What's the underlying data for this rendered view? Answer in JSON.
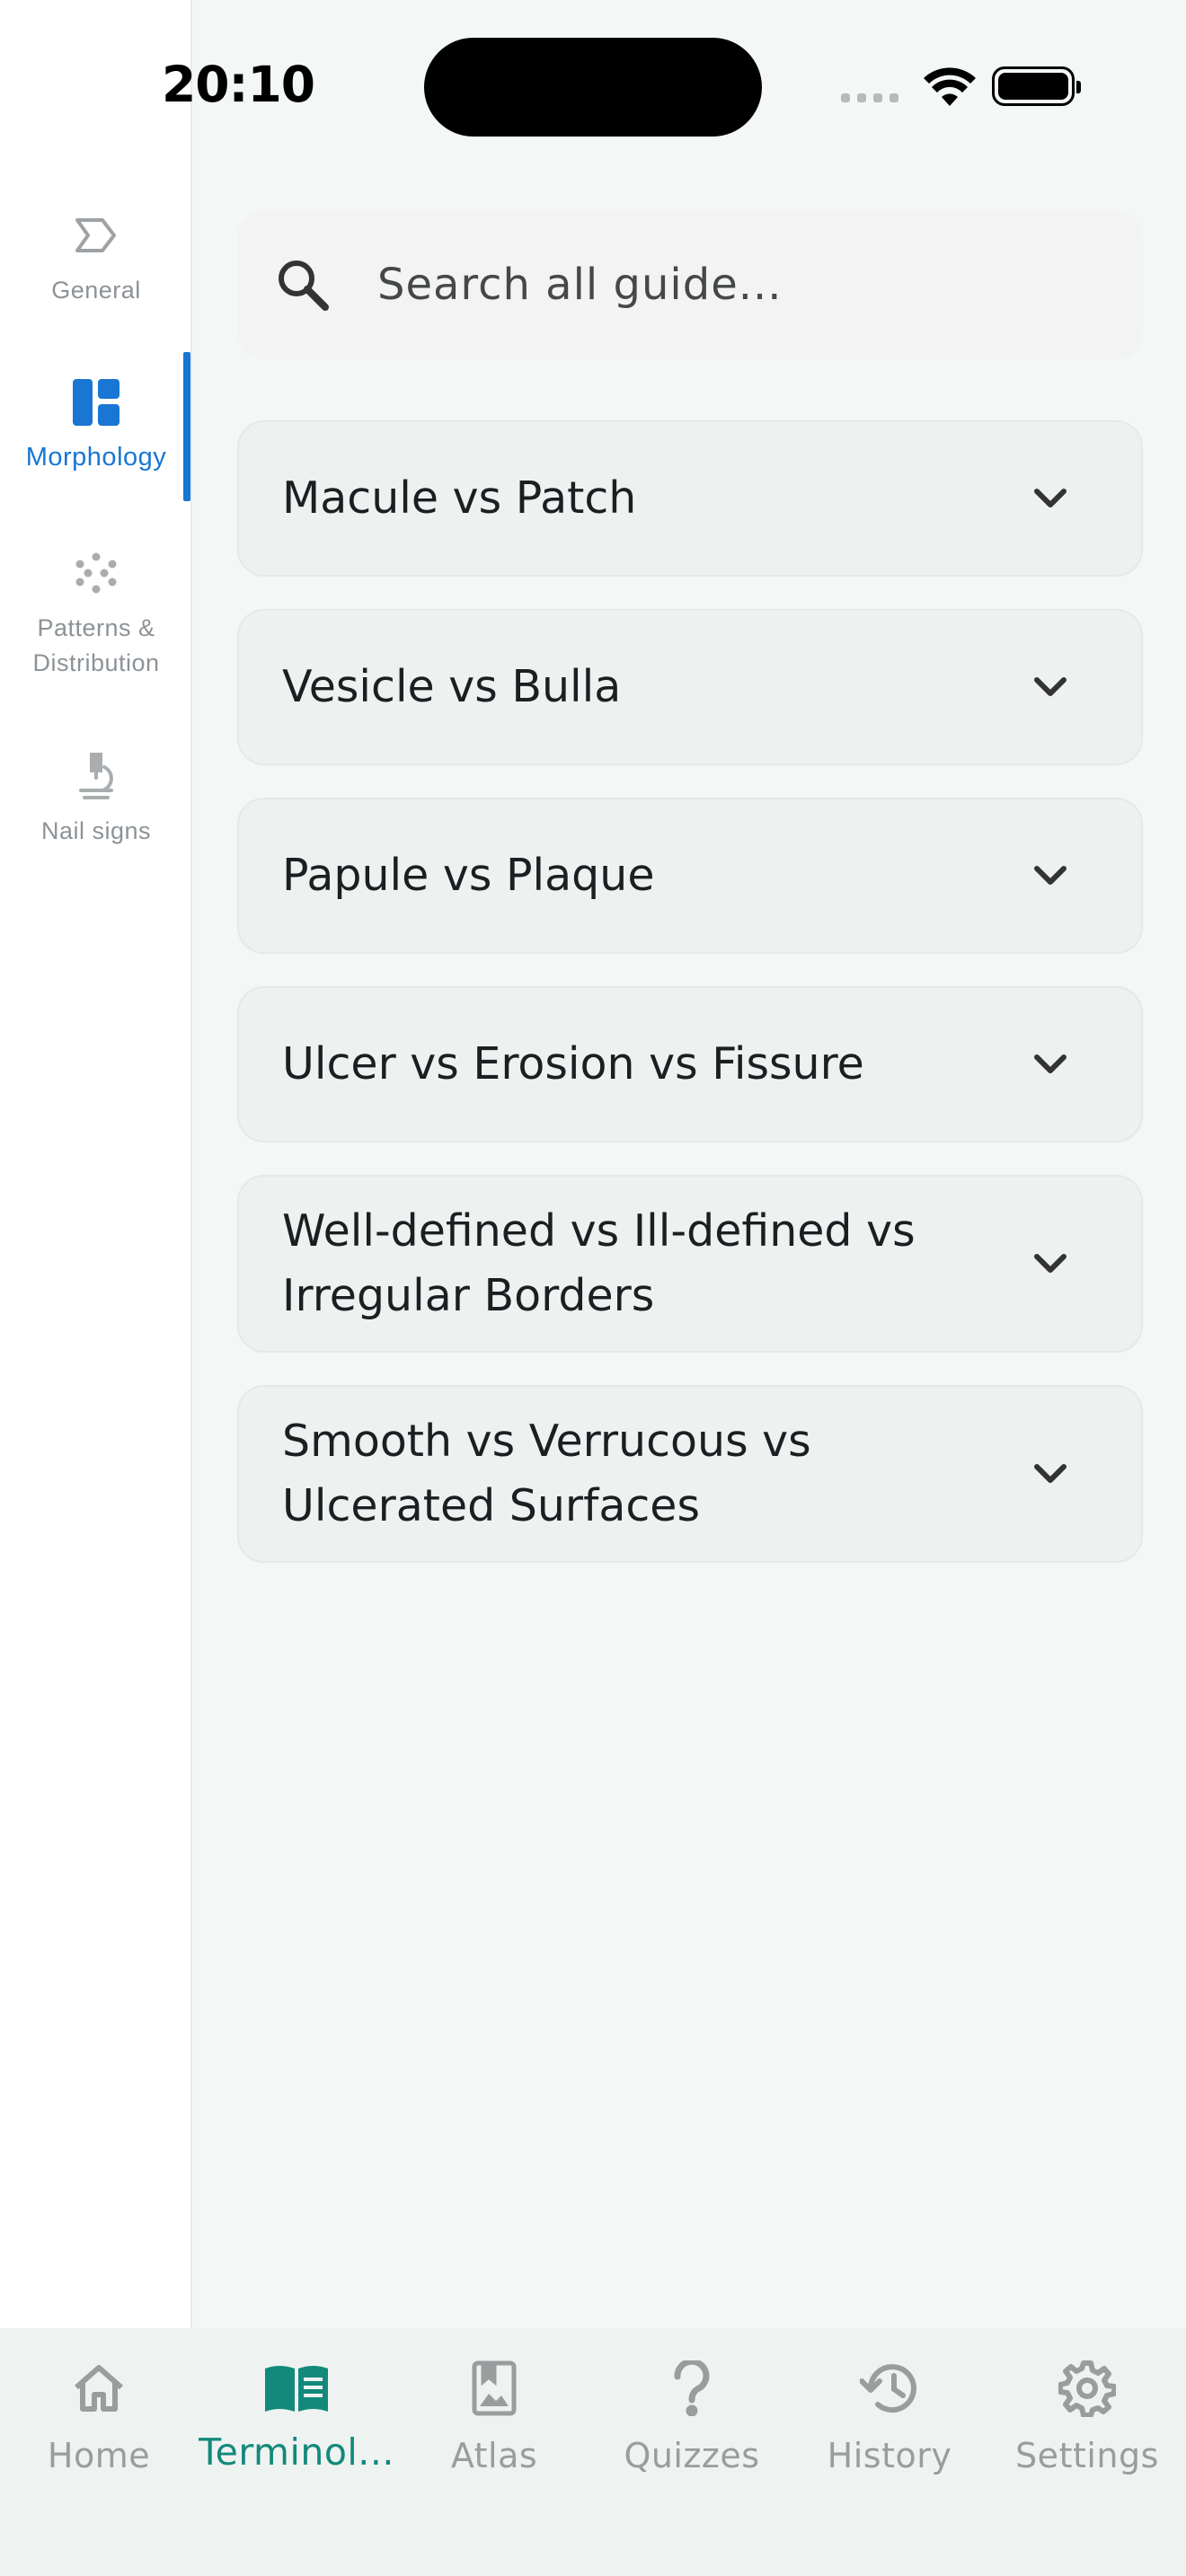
{
  "status_bar": {
    "time": "20:10"
  },
  "sidebar": {
    "items": [
      {
        "label": "General",
        "icon": "label-outline-icon",
        "active": false
      },
      {
        "label": "Morphology",
        "icon": "dashboard-icon",
        "active": true
      },
      {
        "label": "Patterns & Distribution",
        "icon": "grain-dots-icon",
        "active": false
      },
      {
        "label": "Nail signs",
        "icon": "microscope-icon",
        "active": false
      }
    ]
  },
  "search": {
    "placeholder": "Search all guide..."
  },
  "accordion": {
    "items": [
      {
        "title": "Macule vs Patch",
        "expanded": false
      },
      {
        "title": "Vesicle vs Bulla",
        "expanded": false
      },
      {
        "title": "Papule vs Plaque",
        "expanded": false
      },
      {
        "title": "Ulcer vs Erosion vs Fissure",
        "expanded": false
      },
      {
        "title": "Well-defined vs Ill-defined vs Irregular Borders",
        "expanded": false
      },
      {
        "title": "Smooth vs Verrucous vs Ulcerated Surfaces",
        "expanded": false
      }
    ]
  },
  "bottom_nav": {
    "items": [
      {
        "label": "Home",
        "icon": "home-icon",
        "active": false
      },
      {
        "label": "Terminol...",
        "icon": "book-icon",
        "active": true
      },
      {
        "label": "Atlas",
        "icon": "photo-album-icon",
        "active": false
      },
      {
        "label": "Quizzes",
        "icon": "question-mark-icon",
        "active": false
      },
      {
        "label": "History",
        "icon": "history-icon",
        "active": false
      },
      {
        "label": "Settings",
        "icon": "gear-icon",
        "active": false
      }
    ]
  },
  "colors": {
    "accent_blue": "#1976d2",
    "accent_teal": "#12897a",
    "inactive": "#9a9c9e",
    "background": "#f3f7f6"
  }
}
